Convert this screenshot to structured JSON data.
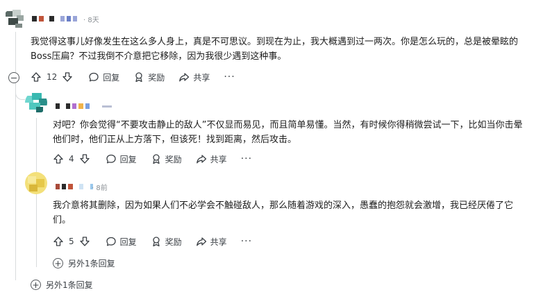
{
  "comments": [
    {
      "time": "·  8天",
      "text": "我觉得这事儿好像发生在这么多人身上，真是不可思议。到现在为止，我大概遇到过一两次。你是怎么玩的，总是被晕眩的Boss压扁？不过我倒不介意把它移除，因为我很少遇到这种事。",
      "votes": "12"
    },
    {
      "time": "",
      "text": "对吧？你会觉得“不要攻击静止的敌人”不仅显而易见，而且简单易懂。当然，有时候你得稍微尝试一下，比如当你击晕他们时，他们正从上方落下，但该死！找到距离，然后攻击。",
      "votes": "4"
    },
    {
      "time": "· 8前",
      "text": "我介意将其删除，因为如果人们不必学会不触碰敌人，那么随着游戏的深入，愚蠢的抱怨就会激增，我已经厌倦了它们。",
      "votes": "5"
    }
  ],
  "actions": {
    "reply": "回复",
    "award": "奖励",
    "share": "共享",
    "more": "···"
  },
  "more_replies": {
    "inner": "另外1条回复",
    "outer": "另外1条回复"
  },
  "colors": {
    "text": "#1c1c1c",
    "muted": "#3a3f44",
    "thread_line": "#d8dbdd"
  }
}
